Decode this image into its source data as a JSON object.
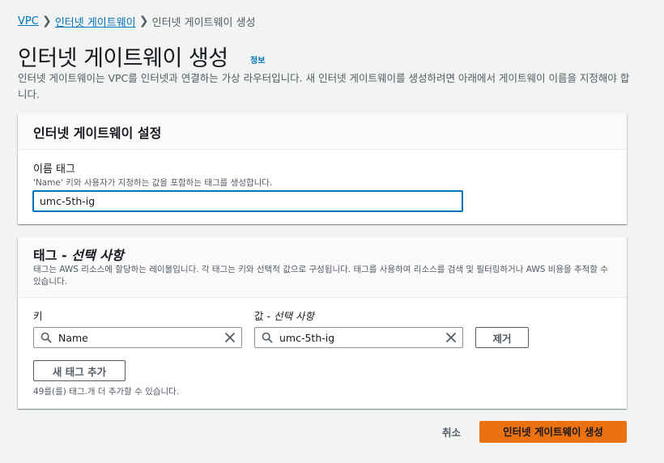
{
  "breadcrumb": {
    "items": [
      "VPC",
      "인터넷 게이트웨이"
    ],
    "separator": "❯",
    "current": "인터넷 게이트웨이 생성"
  },
  "header": {
    "title": "인터넷 게이트웨이 생성",
    "info_label": "정보",
    "description": "인터넷 게이트웨이는 VPC를 인터넷과 연결하는 가상 라우터입니다. 새 인터넷 게이트웨이를 생성하려면 아래에서 게이트웨이 이름을 지정해야 합니다."
  },
  "settings_panel": {
    "title": "인터넷 게이트웨이 설정",
    "name_tag_label": "이름 태그",
    "name_tag_description": "'Name' 키와 사용자가 지정하는 값을 포함하는 태그를 생성합니다.",
    "name_tag_value": "umc-5th-ig"
  },
  "tags_panel": {
    "title_main": "태그 - ",
    "title_optional": "선택 사항",
    "description": "태그는 AWS 리소스에 할당하는 레이블입니다. 각 태그는 키와 선택적 값으로 구성됩니다. 태그를 사용하여 리소스를 검색 및 필터링하거나 AWS 비용을 추적할 수 있습니다.",
    "key_label": "키",
    "value_label_main": "값 - ",
    "value_label_optional": "선택 사항",
    "tags": [
      {
        "key": "Name",
        "value": "umc-5th-ig"
      }
    ],
    "remove_label": "제거",
    "add_tag_label": "새 태그 추가",
    "remaining_hint": "49를(를) 태그.개 더 추가할 수 있습니다."
  },
  "footer": {
    "cancel_label": "취소",
    "create_label": "인터넷 게이트웨이 생성"
  },
  "colors": {
    "link": "#0073bb",
    "primary_button": "#ec7211",
    "focus_border": "#0073bb",
    "page_background": "#f2f3f3"
  },
  "icons": {
    "search": "search-icon",
    "clear": "close-icon",
    "breadcrumb_separator": "chevron-right-icon"
  }
}
